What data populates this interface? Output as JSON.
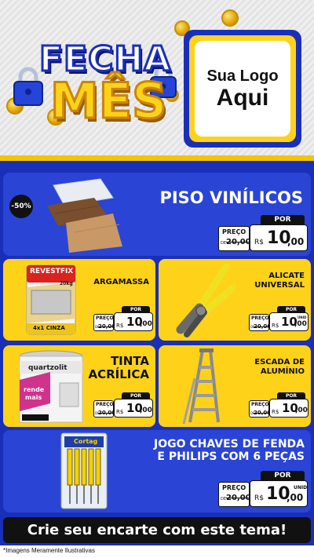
{
  "header": {
    "title_line1": "FECHA",
    "title_line2": "MÊS",
    "logo_line1": "Sua Logo",
    "logo_line2": "Aqui"
  },
  "colors": {
    "blue": "#1a2fb8",
    "card_blue": "#2a44d6",
    "yellow": "#ffd21a",
    "black": "#111111"
  },
  "products": [
    {
      "name": "PISO VINÍLICOS",
      "badge": "-50%",
      "por": "POR",
      "preco": "PREÇO",
      "de": "DE",
      "old_price": "20,00",
      "currency": "R$",
      "price_int": "10",
      "price_dec": ",00",
      "unit": ""
    },
    {
      "name": "ARGAMASSA",
      "por": "POR",
      "preco": "PREÇO",
      "de": "DE",
      "old_price": "20,00",
      "currency": "R$",
      "price_int": "10",
      "price_dec": ",00",
      "unit": ""
    },
    {
      "name": "ALICATE UNIVERSAL",
      "name_l1": "ALICATE",
      "name_l2": "UNIVERSAL",
      "por": "POR",
      "preco": "PREÇO",
      "de": "DE",
      "old_price": "20,00",
      "currency": "R$",
      "price_int": "10",
      "price_dec": ",00",
      "unit": "UNID"
    },
    {
      "name": "TINTA ACRÍLICA",
      "name_l1": "TINTA",
      "name_l2": "ACRÍLICA",
      "por": "POR",
      "preco": "PREÇO",
      "de": "DE",
      "old_price": "20,00",
      "currency": "R$",
      "price_int": "10",
      "price_dec": ",00",
      "unit": ""
    },
    {
      "name": "ESCADA DE ALUMÍNIO",
      "name_l1": "ESCADA DE",
      "name_l2": "ALUMÍNIO",
      "por": "POR",
      "preco": "PREÇO",
      "de": "DE",
      "old_price": "20,00",
      "currency": "R$",
      "price_int": "10",
      "price_dec": ",00",
      "unit": ""
    },
    {
      "name": "JOGO CHAVES DE FENDA E PHILIPS COM 6 PEÇAS",
      "name_l1": "JOGO CHAVES DE FENDA",
      "name_l2": "E PHILIPS COM 6 PEÇAS",
      "por": "POR",
      "preco": "PREÇO",
      "de": "DE",
      "old_price": "20,00",
      "currency": "R$",
      "price_int": "10",
      "price_dec": ",00",
      "unit": "UNID"
    }
  ],
  "product_images": {
    "argamassa_brand": "REVESTFIX",
    "argamassa_weight": "20kg",
    "argamassa_label": "4x1 CINZA",
    "tinta_brand": "quartzolit",
    "tinta_tag1": "rende",
    "tinta_tag2": "mais",
    "chaves_brand": "Cortag"
  },
  "cta": {
    "label": "Crie seu encarte com este tema!"
  },
  "disclaimer": "*Imagens Meramente Ilustrativas"
}
